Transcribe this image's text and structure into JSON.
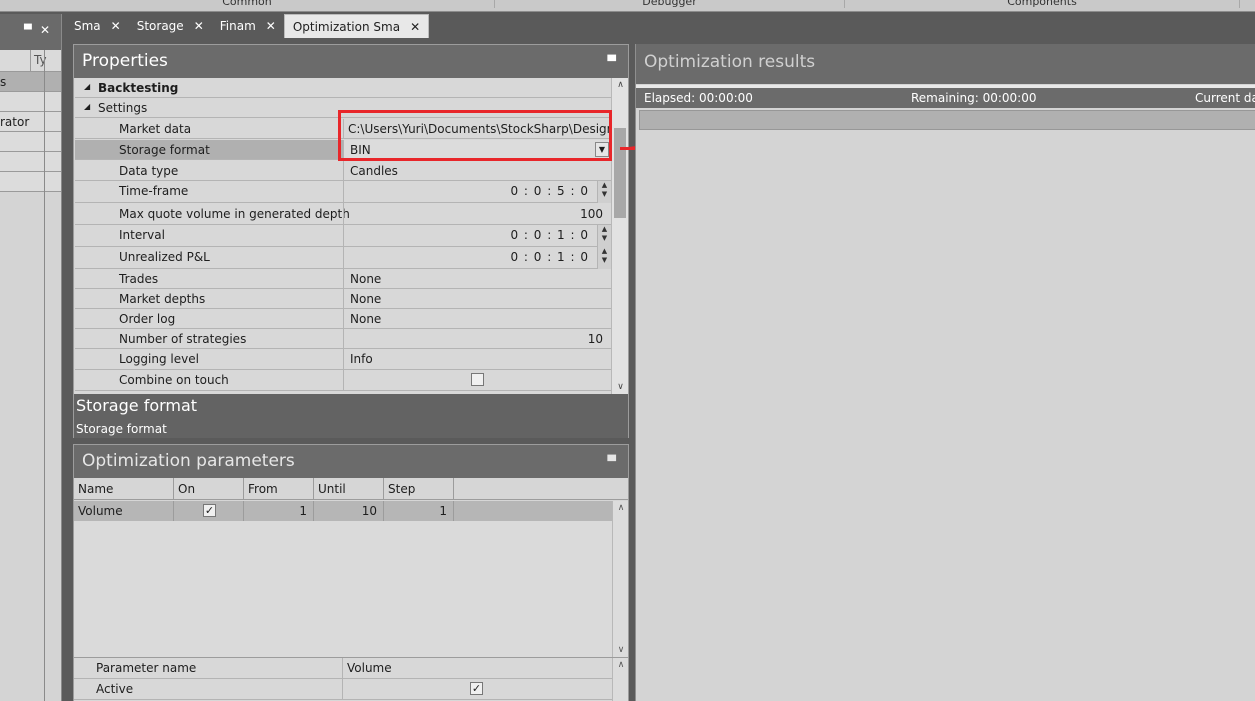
{
  "ribbon": {
    "groups": [
      "Common",
      "Debugger",
      "Components"
    ]
  },
  "left_panel": {
    "column_label": "Ty",
    "rows": [
      "s",
      "",
      "rator",
      "",
      "",
      "",
      ""
    ]
  },
  "tabs": [
    {
      "label": "Sma",
      "close": "✕"
    },
    {
      "label": "Storage",
      "close": "✕"
    },
    {
      "label": "Finam",
      "close": "✕"
    },
    {
      "label": "Optimization Sma",
      "close": "✕"
    }
  ],
  "properties": {
    "title": "Properties",
    "category": "Backtesting",
    "group": "Settings",
    "rows": [
      {
        "name": "Market data",
        "value": "C:\\Users\\Yuri\\Documents\\StockSharp\\Designer..."
      },
      {
        "name": "Storage format",
        "value": "BIN"
      },
      {
        "name": "Data type",
        "value": "Candles"
      },
      {
        "name": "Time-frame",
        "value": "0 : 0 : 5 : 0"
      },
      {
        "name": "Max quote volume in generated depth",
        "value": "100"
      },
      {
        "name": "Interval",
        "value": "0 : 0 : 1 : 0"
      },
      {
        "name": "Unrealized P&L",
        "value": "0 : 0 : 1 : 0"
      },
      {
        "name": "Trades",
        "value": "None"
      },
      {
        "name": "Market depths",
        "value": "None"
      },
      {
        "name": "Order log",
        "value": "None"
      },
      {
        "name": "Number of strategies",
        "value": "10"
      },
      {
        "name": "Logging level",
        "value": "Info"
      },
      {
        "name": "Combine on touch",
        "value": ""
      }
    ],
    "description_title": "Storage format",
    "description_text": "Storage format"
  },
  "optimization_params": {
    "title": "Optimization parameters",
    "columns": [
      "Name",
      "On",
      "From",
      "Until",
      "Step"
    ],
    "row": {
      "name": "Volume",
      "on": true,
      "from": "1",
      "until": "10",
      "step": "1"
    },
    "details": [
      {
        "name": "Parameter name",
        "value": "Volume"
      },
      {
        "name": "Active",
        "value": ""
      }
    ]
  },
  "results": {
    "title": "Optimization results",
    "elapsed": "Elapsed: 00:00:00",
    "remaining": "Remaining: 00:00:00",
    "current": "Current dat"
  },
  "colors": {
    "highlight": "#e8262a",
    "panel_header": "#6b6b6b"
  }
}
